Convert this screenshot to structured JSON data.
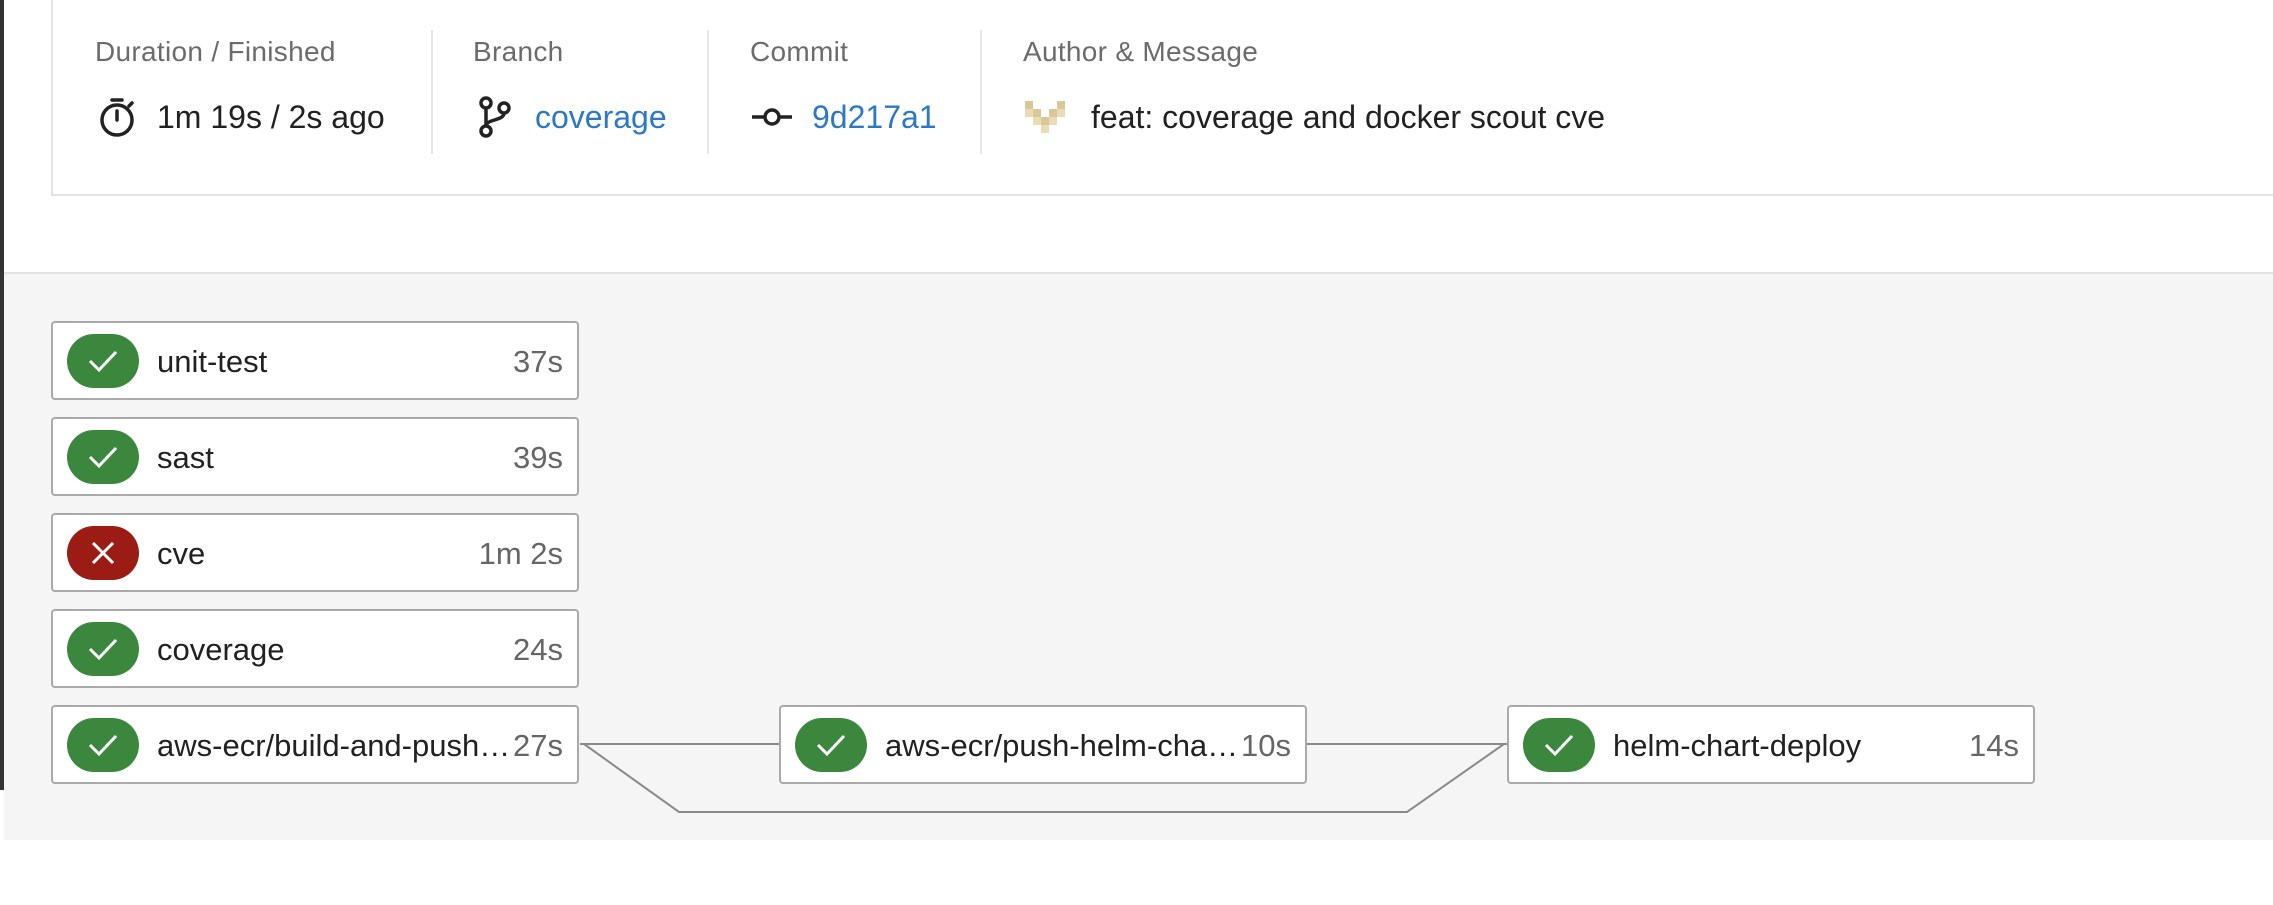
{
  "summary": {
    "duration": {
      "label": "Duration / Finished",
      "value": "1m 19s / 2s ago",
      "icon": "stopwatch-icon"
    },
    "branch": {
      "label": "Branch",
      "value": "coverage",
      "icon": "git-branch-icon"
    },
    "commit": {
      "label": "Commit",
      "value": "9d217a1",
      "icon": "git-commit-icon"
    },
    "author": {
      "label": "Author & Message",
      "message": "feat: coverage and docker scout cve",
      "icon": "author-avatar"
    }
  },
  "jobs": [
    {
      "name": "unit-test",
      "duration": "37s",
      "status": "success"
    },
    {
      "name": "sast",
      "duration": "39s",
      "status": "success"
    },
    {
      "name": "cve",
      "duration": "1m 2s",
      "status": "failed"
    },
    {
      "name": "coverage",
      "duration": "24s",
      "status": "success"
    },
    {
      "name": "aws-ecr/build-and-push…",
      "duration": "27s",
      "status": "success"
    },
    {
      "name": "aws-ecr/push-helm-cha…",
      "duration": "10s",
      "status": "success"
    },
    {
      "name": "helm-chart-deploy",
      "duration": "14s",
      "status": "success"
    }
  ],
  "colors": {
    "success": "#3b873e",
    "failed": "#9a1c14",
    "link": "#2b78c5"
  }
}
